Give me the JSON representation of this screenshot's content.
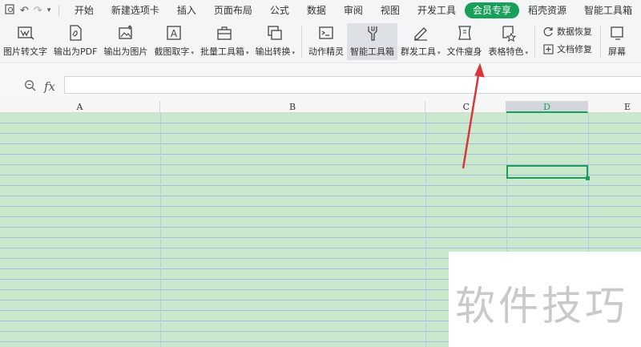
{
  "menu": {
    "tabs": [
      {
        "label": "开始",
        "active": false
      },
      {
        "label": "新建选项卡",
        "active": false
      },
      {
        "label": "插入",
        "active": false
      },
      {
        "label": "页面布局",
        "active": false
      },
      {
        "label": "公式",
        "active": false
      },
      {
        "label": "数据",
        "active": false
      },
      {
        "label": "审阅",
        "active": false
      },
      {
        "label": "视图",
        "active": false
      },
      {
        "label": "开发工具",
        "active": false
      },
      {
        "label": "会员专享",
        "active": true
      },
      {
        "label": "稻壳资源",
        "active": false
      },
      {
        "label": "智能工具箱",
        "active": false
      }
    ]
  },
  "toolbar": {
    "img_to_text": "图片转文字",
    "export_pdf": "输出为PDF",
    "export_img": "输出为图片",
    "screenshot_text": "截图取字",
    "batch_tools": "批量工具箱",
    "export_convert": "输出转换",
    "action_wizard": "动作精灵",
    "smart_toolbox": "智能工具箱",
    "group_tools": "群发工具",
    "file_slim": "文件瘦身",
    "table_features": "表格特色",
    "data_recovery": "数据恢复",
    "doc_repair": "文档修复",
    "screen_rec": "屏幕"
  },
  "formula": {
    "fx_label": "fx",
    "value": ""
  },
  "columns": [
    "A",
    "B",
    "C",
    "D",
    "E"
  ],
  "selected_column": "D",
  "watermark": "软件技巧",
  "colors": {
    "accent": "#18a05a",
    "grid_bg": "#cae8cc",
    "arrow": "#d9383a"
  }
}
